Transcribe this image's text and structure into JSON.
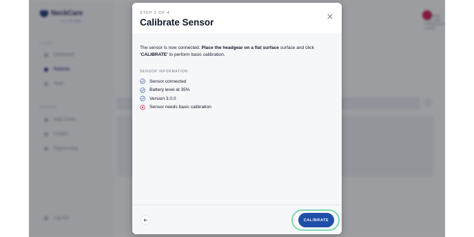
{
  "background_app": {
    "logo_text": "NeckCare",
    "logo_sub": "ALL-IN-ONE",
    "sidebar_section_1": "CLINIC",
    "sidebar_items_1": [
      "Dashboard",
      "Patients",
      "Team"
    ],
    "sidebar_section_2": "SUPPORT",
    "sidebar_items_2": [
      "Help Center",
      "Contact",
      "Report a bug"
    ],
    "logout": "Log Out",
    "user_name": "DR. JANE DOE, SAN FRANCISCO CLINIC"
  },
  "modal": {
    "step": "STEP 2 OF 4",
    "title": "Calibrate Sensor",
    "close_icon": "close-icon",
    "description_parts": {
      "p1": "The sensor is now connected. ",
      "p2": "Place the headgear on a flat surface",
      "p3": " surface and click ",
      "p4": "'CALIBRATE'",
      "p5": " to perform basic calibration."
    },
    "section_label": "SENSOR INFORMATION",
    "checks": [
      {
        "label": "Sensor connected",
        "status": "ok"
      },
      {
        "label": "Battery level at 35%",
        "status": "ok"
      },
      {
        "label": "Version 3.0.0",
        "status": "ok"
      },
      {
        "label": "Sensor needs basic calibration",
        "status": "error"
      }
    ],
    "back_icon": "arrow-left-icon",
    "cta_label": "CALIBRATE"
  },
  "colors": {
    "primary": "#1f4fa8",
    "ok": "#2f5fb3",
    "error": "#d9344a",
    "focus_ring": "#7fd8b3"
  }
}
